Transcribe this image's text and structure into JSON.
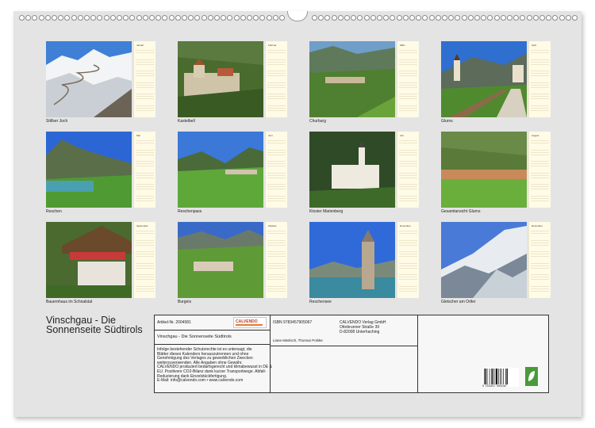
{
  "months": [
    {
      "cal_title": "Januar",
      "caption": "Stilfser Joch"
    },
    {
      "cal_title": "Februar",
      "caption": "Kastelbell"
    },
    {
      "cal_title": "März",
      "caption": "Churburg"
    },
    {
      "cal_title": "April",
      "caption": "Glurns"
    },
    {
      "cal_title": "Mai",
      "caption": "Reschen"
    },
    {
      "cal_title": "Juni",
      "caption": "Reschenpass"
    },
    {
      "cal_title": "Juli",
      "caption": "Kloster Marienberg"
    },
    {
      "cal_title": "August",
      "caption": "Gesamtansicht Glurns"
    },
    {
      "cal_title": "September",
      "caption": "Bauernhaus im Schnalstal"
    },
    {
      "cal_title": "Oktober",
      "caption": "Burgeis"
    },
    {
      "cal_title": "November",
      "caption": "Reschensee"
    },
    {
      "cal_title": "Dezember",
      "caption": "Gletscher am Ortler"
    }
  ],
  "title": "Vinschgau - Die Sonnenseite Südtirols",
  "info": {
    "article": "Artikel-Nr. 2004581",
    "logo_text": "CALVENDO",
    "subtitle": "Vinschgau - Die Sonnenseite Südtirols",
    "isbn": "ISBN 9783457905067",
    "publisher_1": "CALVENDO Verlag GmbH",
    "publisher_2": "Ottobrunner Straße 39",
    "publisher_3": "D-82008 Unterhaching",
    "authors": "Liane Matrisch, Thomas Polske",
    "legal_1": "Infolge bestehender Schutzrechte ist es untersagt, die",
    "legal_2": "Blätter dieses Kalenders herauszutrennen und ohne",
    "legal_3": "Genehmigung des Verlages zu gewerblichen Zwecken",
    "legal_4": "weiterzuverwenden. Alle Angaben ohne Gewähr.",
    "legal_5": "CALVENDO produziert bedarfsgerecht und klimabewusst in DE &",
    "legal_6": "EU. Positivere CO2-Bilanz dank kurzer Transportwege. Abfall-",
    "legal_7": "Reduzierung dank Einzelstückfertigung.",
    "legal_8": "E-Mail: info@calvendo.com • www.calvendo.com",
    "barcode_digits": "9 783457 905067"
  }
}
